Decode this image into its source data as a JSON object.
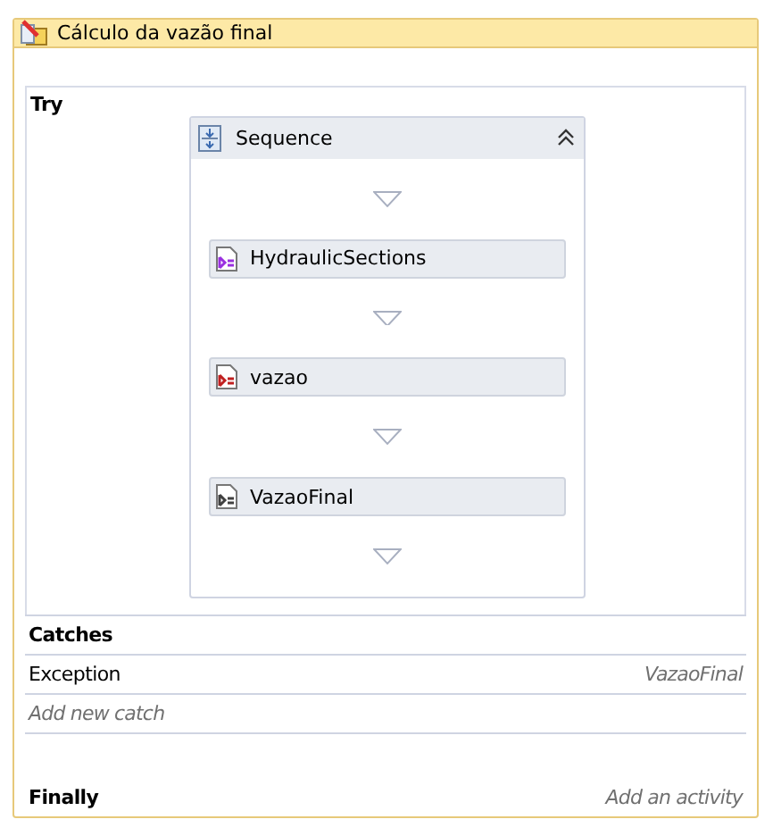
{
  "activity": {
    "title": "Cálculo da vazão final"
  },
  "try": {
    "label": "Try",
    "sequence": {
      "title": "Sequence",
      "expanded": true,
      "activities": [
        {
          "name": "HydraulicSections",
          "color": "#9a30e0"
        },
        {
          "name": "vazao",
          "color": "#c02020"
        },
        {
          "name": "VazaoFinal",
          "color": "#404040"
        }
      ]
    }
  },
  "catches": {
    "label": "Catches",
    "items": [
      {
        "exception": "Exception",
        "handler": "VazaoFinal"
      }
    ],
    "add_placeholder": "Add new catch"
  },
  "finally": {
    "label": "Finally",
    "placeholder": "Add an activity"
  }
}
